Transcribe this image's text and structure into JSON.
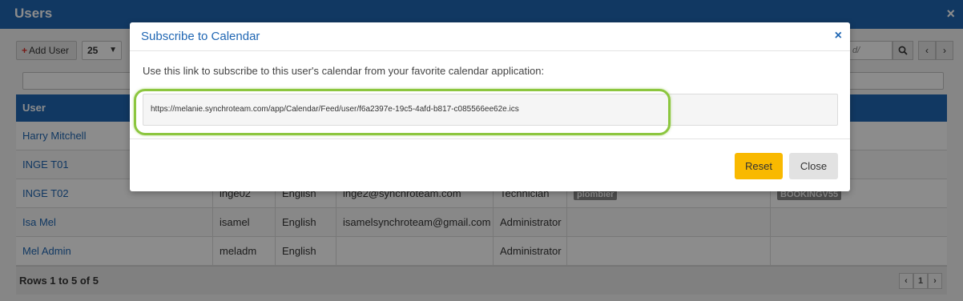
{
  "window": {
    "title": "Users",
    "close_icon": "×"
  },
  "toolbar": {
    "add_user_label": "Add User",
    "add_icon": "+",
    "page_size": "25",
    "search_placeholder": "d/",
    "search_icon": "search-icon",
    "prev_icon": "‹",
    "next_icon": "›"
  },
  "grid": {
    "header_user": "User",
    "rows": [
      {
        "user": "Harry Mitchell",
        "login": "",
        "language": "",
        "email": "",
        "role": "",
        "tags": "",
        "extra": ""
      },
      {
        "user": "INGE T01",
        "login": "",
        "language": "",
        "email": "",
        "role": "",
        "tags": "",
        "extra": ""
      },
      {
        "user": "INGE T02",
        "login": "inge02",
        "language": "English",
        "email": "inge2@synchroteam.com",
        "role": "Technician",
        "tags": "plombier",
        "extra": "BOOKINGV55"
      },
      {
        "user": "Isa Mel",
        "login": "isamel",
        "language": "English",
        "email": "isamelsynchroteam@gmail.com",
        "role": "Administrator",
        "tags": "",
        "extra": ""
      },
      {
        "user": "Mel Admin",
        "login": "meladm",
        "language": "English",
        "email": "",
        "role": "Administrator",
        "tags": "",
        "extra": ""
      }
    ],
    "footer_text": "Rows 1 to 5 of 5",
    "current_page": "1"
  },
  "modal": {
    "title": "Subscribe to Calendar",
    "close_icon": "×",
    "description": "Use this link to subscribe to this user's calendar from your favorite calendar application:",
    "feed_url": "https://melanie.synchroteam.com/app/Calendar/Feed/user/f6a2397e-19c5-4afd-b817-c085566ee62e.ics",
    "reset_label": "Reset",
    "close_label": "Close",
    "highlight_color": "#8cc63f",
    "reset_color": "#f9b900"
  }
}
